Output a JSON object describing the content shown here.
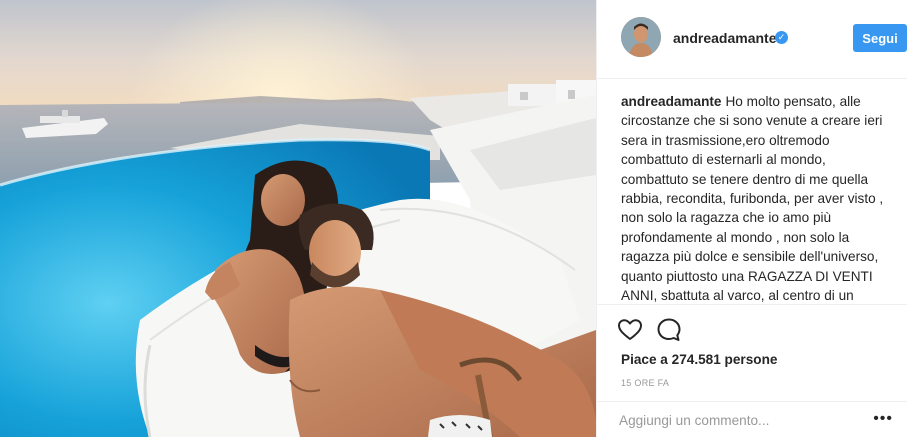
{
  "post": {
    "image": {
      "alt_icon": "photo-couple-selfie-pool",
      "colors": {
        "sky_top": "#c7cbd3",
        "sunset": "#f2dcc0",
        "sea": "#8fa7b8",
        "pool": "#1aa3d8",
        "cushion": "#f6f6f4"
      }
    },
    "header": {
      "username": "andreadamante",
      "verified_icon": "verified-badge-icon",
      "follow_label": "Segui",
      "follow_color": "#3897f0"
    },
    "caption": {
      "username": "andreadamante",
      "text": "Ho molto pensato, alle circostanze che si sono venute a creare ieri sera in trasmissione,ero oltremodo combattuto di esternarli al mondo, combattuto se tenere dentro di me quella rabbia, recondita, furibonda, per aver visto , non solo la ragazza che io amo più profondamente al mondo , non solo la ragazza più dolce e sensibile dell'universo, quanto piuttosto una RAGAZZA DI VENTI ANNI, sbattuta al varco, al centro di un dibattito che ha superato ogni limite di"
    },
    "actions": {
      "like_icon": "heart-icon",
      "comment_icon": "comment-bubble-icon",
      "likes_text": "Piace a 274.581 persone",
      "time_text": "15 ORE FA"
    },
    "add_comment": {
      "placeholder": "Aggiungi un commento...",
      "more_icon": "more-options-icon",
      "more_label": "•••"
    }
  }
}
